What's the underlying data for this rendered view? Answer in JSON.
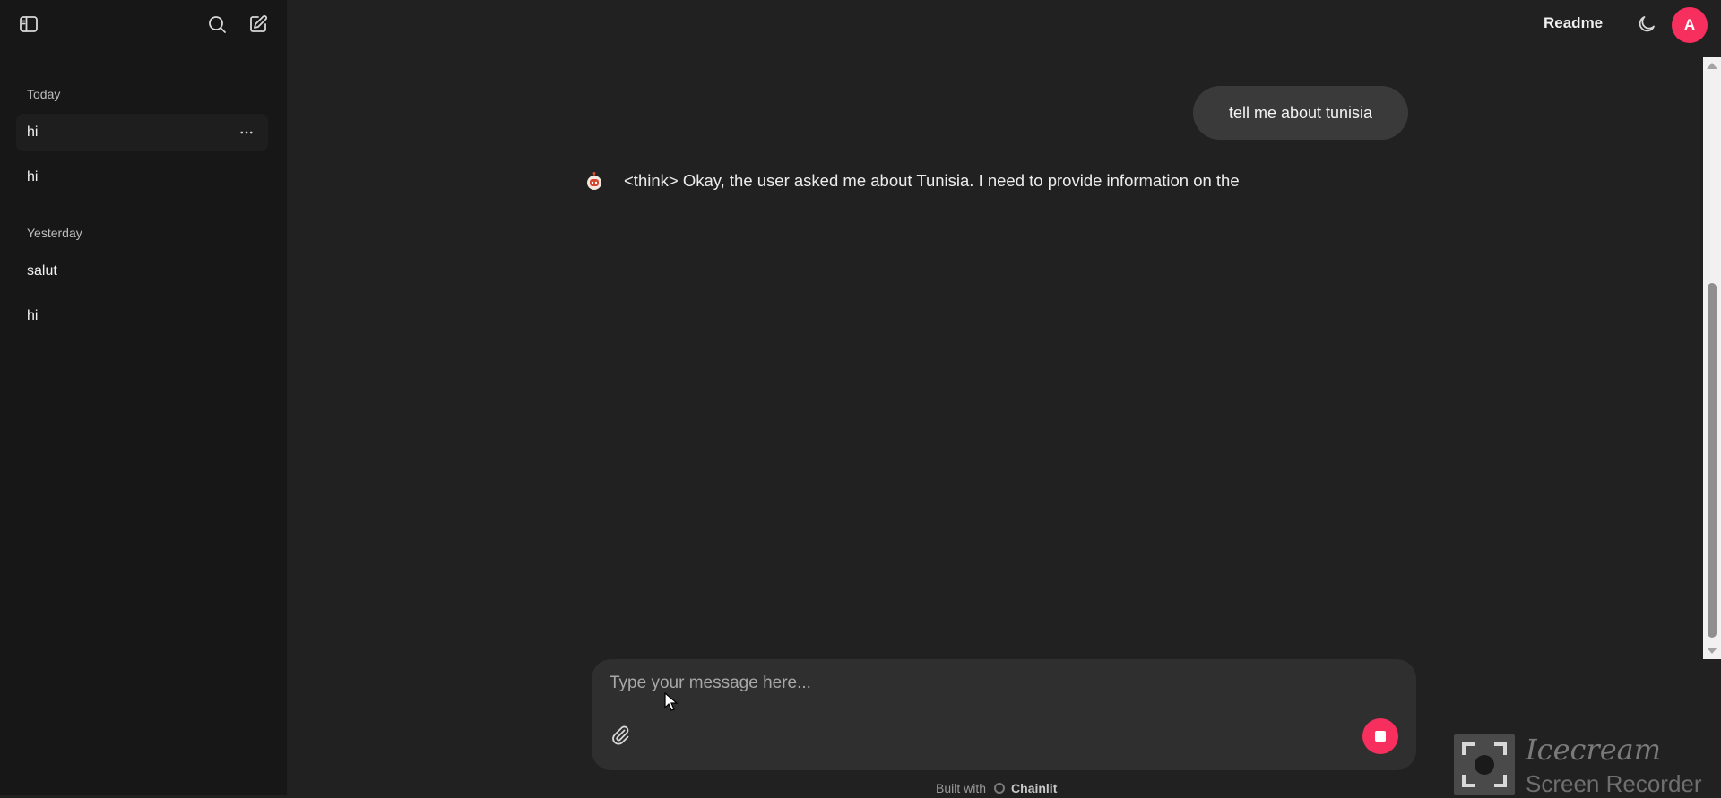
{
  "sidebar": {
    "groups": [
      {
        "label": "Today",
        "threads": [
          "hi",
          "hi"
        ]
      },
      {
        "label": "Yesterday",
        "threads": [
          "salut",
          "hi"
        ]
      }
    ]
  },
  "header": {
    "readme_label": "Readme",
    "avatar_initial": "A"
  },
  "chat": {
    "user_message": "tell me about tunisia",
    "assistant_message": "<think> Okay, the user asked me about Tunisia. I need to provide information on the"
  },
  "composer": {
    "placeholder": "Type your message here..."
  },
  "footer": {
    "built_with": "Built with",
    "brand": "Chainlit"
  },
  "watermark": {
    "title": "Icecream",
    "subtitle": "Screen Recorder"
  },
  "colors": {
    "accent": "#f72f5e",
    "background": "#212121",
    "sidebar": "#171717",
    "bubble": "#3a3a3a",
    "composer": "#2f2f2f"
  }
}
